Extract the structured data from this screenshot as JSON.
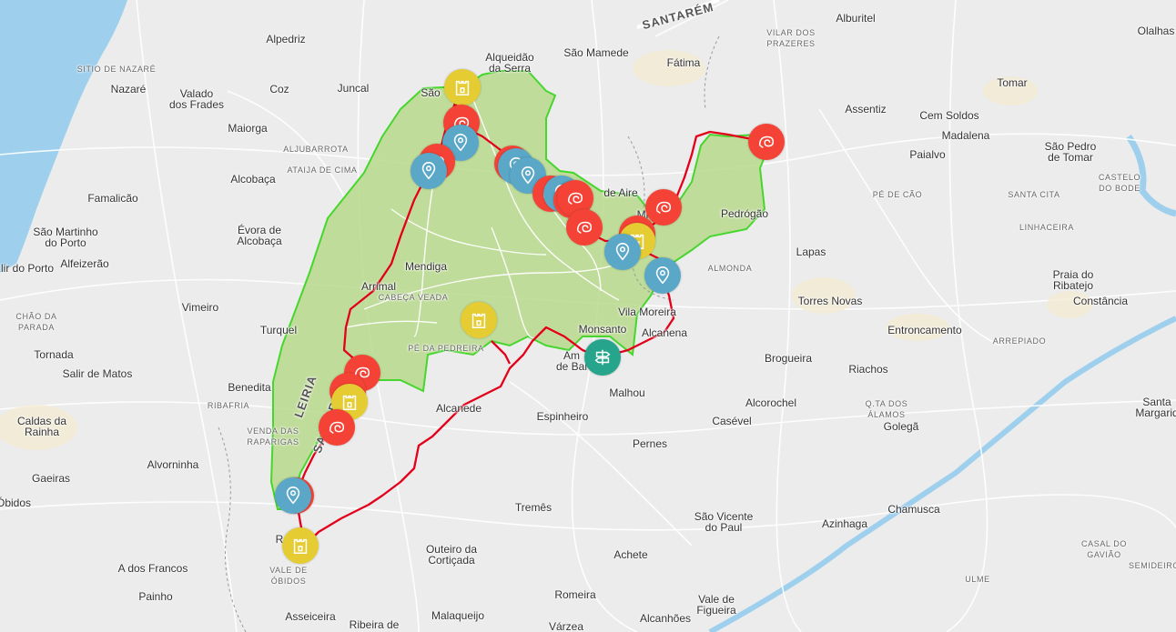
{
  "colors": {
    "sea": "#9ed0ee",
    "land": "#ececec",
    "park_fill": "#b9d98c",
    "park_border": "#46d62d",
    "route": "#e3001b",
    "marker_red": "#f44336",
    "marker_blue": "#5aa7c8",
    "marker_yellow": "#e6cc33",
    "marker_teal": "#26a58c"
  },
  "places": [
    {
      "name": "Alpedriz",
      "class": "town"
    },
    {
      "name": "Alqueidão\nda Serra",
      "class": "town"
    },
    {
      "name": "São Mamede",
      "class": "town"
    },
    {
      "name": "Fátima",
      "class": "town"
    },
    {
      "name": "Alburitel",
      "class": "town"
    },
    {
      "name": "Olalhas",
      "class": "town"
    },
    {
      "name": "SANTARÉM",
      "class": "road"
    },
    {
      "name": "VILAR DOS\nPRAZERES",
      "class": "minor"
    },
    {
      "name": "SITIO DE NAZARÉ",
      "class": "minor"
    },
    {
      "name": "Nazaré",
      "class": "town"
    },
    {
      "name": "Valado\ndos Frades",
      "class": "town"
    },
    {
      "name": "Coz",
      "class": "town"
    },
    {
      "name": "Juncal",
      "class": "town"
    },
    {
      "name": "São",
      "class": "town"
    },
    {
      "name": "Tomar",
      "class": "town"
    },
    {
      "name": "Assentiz",
      "class": "town"
    },
    {
      "name": "Cem Soldos",
      "class": "town"
    },
    {
      "name": "Madalena",
      "class": "town"
    },
    {
      "name": "Maiorga",
      "class": "town"
    },
    {
      "name": "ALJUBARROTA",
      "class": "minor"
    },
    {
      "name": "ATAIJA DE CIMA",
      "class": "minor"
    },
    {
      "name": "Alcobaça",
      "class": "town"
    },
    {
      "name": "São Pedro\nde Tomar",
      "class": "town"
    },
    {
      "name": "Paialvo",
      "class": "town"
    },
    {
      "name": "CASTELO\nDO BODE",
      "class": "minor"
    },
    {
      "name": "Famalicão",
      "class": "town"
    },
    {
      "name": "de Aire",
      "class": "town"
    },
    {
      "name": "PÉ DE CÃO",
      "class": "minor"
    },
    {
      "name": "SANTA CITA",
      "class": "minor"
    },
    {
      "name": "Pedrógão",
      "class": "town"
    },
    {
      "name": "Mi",
      "class": "town"
    },
    {
      "name": "LINHACEIRA",
      "class": "minor"
    },
    {
      "name": "São Martinho\ndo Porto",
      "class": "town"
    },
    {
      "name": "Évora de\nAlcobaça",
      "class": "town"
    },
    {
      "name": "Alfeizerão",
      "class": "town"
    },
    {
      "name": "lir do Porto",
      "class": "town"
    },
    {
      "name": "Mendiga",
      "class": "town"
    },
    {
      "name": "Lapas",
      "class": "town"
    },
    {
      "name": "ALMONDA",
      "class": "minor"
    },
    {
      "name": "Praia do\nRibatejo",
      "class": "town"
    },
    {
      "name": "Arrimal",
      "class": "town"
    },
    {
      "name": "CABEÇA VEADA",
      "class": "minor"
    },
    {
      "name": "Vimeiro",
      "class": "town"
    },
    {
      "name": "Torres Novas",
      "class": "town"
    },
    {
      "name": "Constância",
      "class": "town"
    },
    {
      "name": "CHÃO DA\nPARADA",
      "class": "minor"
    },
    {
      "name": "Vila Moreira",
      "class": "town"
    },
    {
      "name": "Turquel",
      "class": "town"
    },
    {
      "name": "Monsanto",
      "class": "town"
    },
    {
      "name": "Entroncamento",
      "class": "town"
    },
    {
      "name": "Alcanena",
      "class": "town"
    },
    {
      "name": "PÉ DA PEDREIRA",
      "class": "minor"
    },
    {
      "name": "ARREPIADO",
      "class": "minor"
    },
    {
      "name": "Tornada",
      "class": "town"
    },
    {
      "name": "Am\nde Bai",
      "class": "town"
    },
    {
      "name": "Brogueira",
      "class": "town"
    },
    {
      "name": "Salir de Matos",
      "class": "town"
    },
    {
      "name": "Benedita",
      "class": "town"
    },
    {
      "name": "Riachos",
      "class": "town"
    },
    {
      "name": "LEIRIA",
      "class": "road"
    },
    {
      "name": "RIBAFRIA",
      "class": "minor"
    },
    {
      "name": "Malhou",
      "class": "town"
    },
    {
      "name": "Alcorochel",
      "class": "town"
    },
    {
      "name": "Alcanede",
      "class": "town"
    },
    {
      "name": "Santa\nMargarid",
      "class": "town"
    },
    {
      "name": "Q.TA DOS\nÁLAMOS",
      "class": "minor"
    },
    {
      "name": "Caldas da\nRainha",
      "class": "town"
    },
    {
      "name": "Espinheiro",
      "class": "town"
    },
    {
      "name": "Casével",
      "class": "town"
    },
    {
      "name": "Golegã",
      "class": "town"
    },
    {
      "name": "SANTARÉM",
      "class": "road"
    },
    {
      "name": "VENDA DAS\nRAPARIGAS",
      "class": "minor"
    },
    {
      "name": "Pernes",
      "class": "town"
    },
    {
      "name": "Alvorninha",
      "class": "town"
    },
    {
      "name": "Gaeiras",
      "class": "town"
    },
    {
      "name": "Óbidos",
      "class": "town"
    },
    {
      "name": "Tremês",
      "class": "town"
    },
    {
      "name": "Chamusca",
      "class": "town"
    },
    {
      "name": "São Vicente\ndo Paul",
      "class": "town"
    },
    {
      "name": "Azinhaga",
      "class": "town"
    },
    {
      "name": "R",
      "class": "town"
    },
    {
      "name": "Outeiro da\nCortiçada",
      "class": "town"
    },
    {
      "name": "Achete",
      "class": "town"
    },
    {
      "name": "CASAL DO\nGAVIÃO",
      "class": "minor"
    },
    {
      "name": "A dos Francos",
      "class": "town"
    },
    {
      "name": "VALE DE\nÓBIDOS",
      "class": "minor"
    },
    {
      "name": "ULME",
      "class": "minor"
    },
    {
      "name": "SEMIDEIRO",
      "class": "minor"
    },
    {
      "name": "Painho",
      "class": "town"
    },
    {
      "name": "Romeira",
      "class": "town"
    },
    {
      "name": "Vale de\nFigueira",
      "class": "town"
    },
    {
      "name": "Asseiceira",
      "class": "town"
    },
    {
      "name": "Ribeira de",
      "class": "town"
    },
    {
      "name": "Malaqueijo",
      "class": "town"
    },
    {
      "name": "Várzea",
      "class": "town"
    },
    {
      "name": "Alcanhões",
      "class": "town"
    }
  ],
  "markers": [
    {
      "type": "yellow",
      "icon": "fortress-icon"
    },
    {
      "type": "red",
      "icon": "fossil-icon"
    },
    {
      "type": "blue",
      "icon": "location-pin-icon"
    },
    {
      "type": "red",
      "icon": "fossil-icon"
    },
    {
      "type": "blue",
      "icon": "location-pin-icon"
    },
    {
      "type": "red",
      "icon": "fossil-icon"
    },
    {
      "type": "blue",
      "icon": "location-pin-icon"
    },
    {
      "type": "blue",
      "icon": "location-pin-icon"
    },
    {
      "type": "red",
      "icon": "fossil-icon"
    },
    {
      "type": "blue",
      "icon": "location-pin-icon"
    },
    {
      "type": "red",
      "icon": "fossil-icon"
    },
    {
      "type": "red",
      "icon": "fossil-icon"
    },
    {
      "type": "red",
      "icon": "fossil-icon"
    },
    {
      "type": "red",
      "icon": "fossil-icon"
    },
    {
      "type": "yellow",
      "icon": "fortress-icon"
    },
    {
      "type": "blue",
      "icon": "location-pin-icon"
    },
    {
      "type": "red",
      "icon": "fossil-icon"
    },
    {
      "type": "blue",
      "icon": "location-pin-icon"
    },
    {
      "type": "red",
      "icon": "fossil-icon"
    },
    {
      "type": "yellow",
      "icon": "fortress-icon"
    },
    {
      "type": "teal",
      "icon": "signpost-icon"
    },
    {
      "type": "red",
      "icon": "fossil-icon"
    },
    {
      "type": "red",
      "icon": "fossil-icon"
    },
    {
      "type": "yellow",
      "icon": "fortress-icon"
    },
    {
      "type": "red",
      "icon": "fossil-icon"
    },
    {
      "type": "red",
      "icon": "fossil-icon"
    },
    {
      "type": "blue",
      "icon": "location-pin-icon"
    },
    {
      "type": "yellow",
      "icon": "fortress-icon"
    }
  ]
}
